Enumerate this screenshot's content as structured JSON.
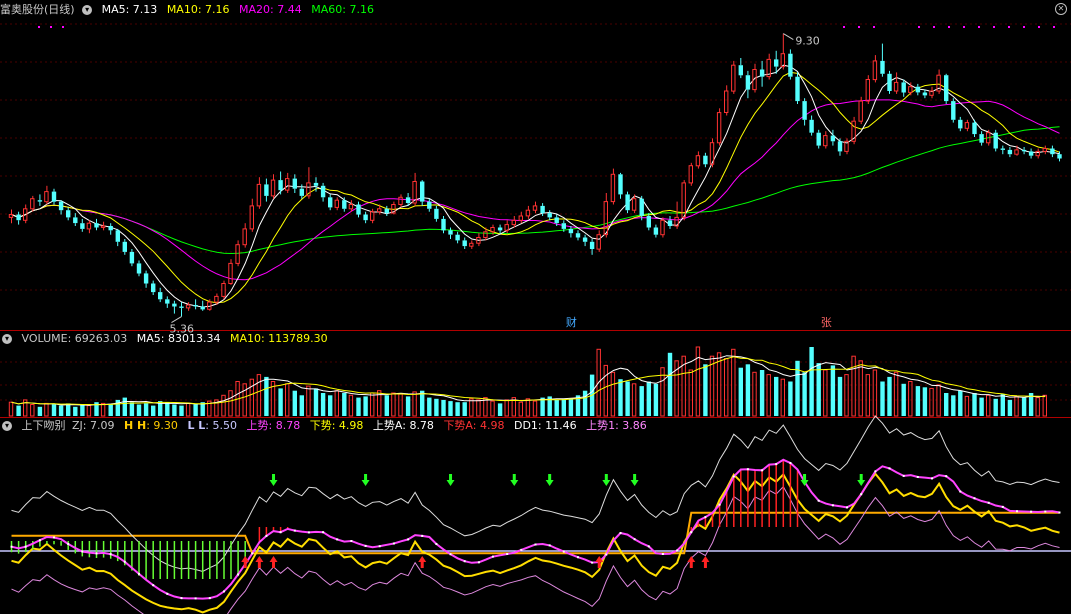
{
  "colors": {
    "up": "#ff3232",
    "down": "#54ffff",
    "ma5": "#ffffff",
    "ma10": "#ffff00",
    "ma20": "#ff00ff",
    "ma60": "#00ff00",
    "pane_border": "#b00000"
  },
  "price_panel": {
    "title": "富奥股份(日线)",
    "ma5": "MA5: 7.13",
    "ma10": "MA10: 7.16",
    "ma20": "MA20: 7.44",
    "ma60": "MA60: 7.16",
    "high_label": "9.30",
    "low_label": "5.36",
    "marker_cai": "财",
    "marker_zhang": "张"
  },
  "volume_panel": {
    "volume": "VOLUME: 69263.03",
    "ma5": "MA5: 83013.34",
    "ma10": "MA10: 113789.30"
  },
  "indicator_panel": {
    "name": "上下吻别",
    "zj": "ZJ: 7.09",
    "hh_label": "H H",
    "hh_value": ": 9.30",
    "ll_label": "L L",
    "ll_value": ": 5.50",
    "up_trend": "上势: 8.78",
    "down_trend": "下势: 4.98",
    "up_trend_a": "上势A: 8.78",
    "down_trend_a": "下势A: 4.98",
    "dd1": "DD1: 11.46",
    "up_trend_1": "上势1: 3.86"
  },
  "chart_data": {
    "type": "candlestick",
    "y_range": [
      5.2,
      9.35
    ],
    "high": 9.3,
    "low": 5.36,
    "candles": [
      [
        6.74,
        6.78,
        6.85,
        6.66
      ],
      [
        6.78,
        6.7,
        6.82,
        6.64
      ],
      [
        6.7,
        6.86,
        6.92,
        6.66
      ],
      [
        6.86,
        7.0,
        7.04,
        6.82
      ],
      [
        6.98,
        6.96,
        7.06,
        6.9
      ],
      [
        6.96,
        7.1,
        7.18,
        6.92
      ],
      [
        7.1,
        6.96,
        7.14,
        6.92
      ],
      [
        6.96,
        6.84,
        6.98,
        6.78
      ],
      [
        6.84,
        6.74,
        6.88,
        6.7
      ],
      [
        6.74,
        6.66,
        6.8,
        6.62
      ],
      [
        6.66,
        6.58,
        6.72,
        6.54
      ],
      [
        6.58,
        6.66,
        6.7,
        6.52
      ],
      [
        6.66,
        6.6,
        6.72,
        6.56
      ],
      [
        6.6,
        6.62,
        6.68,
        6.56
      ],
      [
        6.62,
        6.56,
        6.66,
        6.5
      ],
      [
        6.56,
        6.4,
        6.58,
        6.34
      ],
      [
        6.4,
        6.26,
        6.44,
        6.22
      ],
      [
        6.26,
        6.1,
        6.3,
        6.06
      ],
      [
        6.1,
        5.96,
        6.14,
        5.92
      ],
      [
        5.96,
        5.82,
        6.0,
        5.76
      ],
      [
        5.82,
        5.7,
        5.86,
        5.66
      ],
      [
        5.7,
        5.6,
        5.76,
        5.56
      ],
      [
        5.6,
        5.54,
        5.64,
        5.48
      ],
      [
        5.54,
        5.5,
        5.58,
        5.4
      ],
      [
        5.5,
        5.48,
        5.56,
        5.36
      ],
      [
        5.48,
        5.52,
        5.56,
        5.44
      ],
      [
        5.52,
        5.5,
        5.6,
        5.46
      ],
      [
        5.5,
        5.46,
        5.58,
        5.44
      ],
      [
        5.46,
        5.56,
        5.6,
        5.44
      ],
      [
        5.56,
        5.64,
        5.68,
        5.52
      ],
      [
        5.64,
        5.82,
        5.86,
        5.6
      ],
      [
        5.82,
        6.1,
        6.16,
        5.8
      ],
      [
        6.1,
        6.36,
        6.42,
        6.06
      ],
      [
        6.36,
        6.58,
        6.66,
        6.32
      ],
      [
        6.58,
        6.9,
        7.0,
        6.54
      ],
      [
        6.9,
        7.2,
        7.3,
        6.86
      ],
      [
        7.2,
        7.04,
        7.28,
        6.96
      ],
      [
        7.04,
        7.26,
        7.34,
        7.0
      ],
      [
        7.26,
        7.12,
        7.38,
        7.06
      ],
      [
        7.12,
        7.28,
        7.36,
        7.08
      ],
      [
        7.28,
        7.14,
        7.34,
        7.08
      ],
      [
        7.14,
        7.04,
        7.2,
        7.0
      ],
      [
        7.04,
        7.22,
        7.44,
        7.0
      ],
      [
        7.22,
        7.18,
        7.3,
        7.1
      ],
      [
        7.18,
        7.02,
        7.22,
        6.96
      ],
      [
        7.02,
        6.88,
        7.06,
        6.84
      ],
      [
        6.88,
        6.98,
        7.02,
        6.84
      ],
      [
        6.98,
        6.86,
        7.02,
        6.82
      ],
      [
        6.86,
        6.92,
        6.98,
        6.82
      ],
      [
        6.92,
        6.78,
        6.96,
        6.74
      ],
      [
        6.78,
        6.7,
        6.82,
        6.66
      ],
      [
        6.7,
        6.82,
        6.86,
        6.66
      ],
      [
        6.82,
        6.86,
        6.92,
        6.78
      ],
      [
        6.86,
        6.8,
        6.9,
        6.76
      ],
      [
        6.8,
        6.92,
        6.96,
        6.78
      ],
      [
        6.92,
        7.02,
        7.06,
        6.88
      ],
      [
        7.02,
        6.94,
        7.08,
        6.9
      ],
      [
        6.94,
        7.24,
        7.36,
        6.9
      ],
      [
        7.24,
        6.96,
        7.26,
        6.9
      ],
      [
        6.96,
        6.86,
        7.0,
        6.82
      ],
      [
        6.86,
        6.72,
        6.9,
        6.68
      ],
      [
        6.72,
        6.56,
        6.76,
        6.52
      ],
      [
        6.56,
        6.5,
        6.6,
        6.44
      ],
      [
        6.5,
        6.42,
        6.54,
        6.38
      ],
      [
        6.42,
        6.34,
        6.46,
        6.3
      ],
      [
        6.34,
        6.38,
        6.42,
        6.3
      ],
      [
        6.38,
        6.46,
        6.52,
        6.34
      ],
      [
        6.46,
        6.54,
        6.6,
        6.42
      ],
      [
        6.54,
        6.6,
        6.64,
        6.5
      ],
      [
        6.6,
        6.56,
        6.64,
        6.52
      ],
      [
        6.56,
        6.64,
        6.7,
        6.52
      ],
      [
        6.64,
        6.7,
        6.76,
        6.6
      ],
      [
        6.7,
        6.76,
        6.82,
        6.66
      ],
      [
        6.76,
        6.84,
        6.9,
        6.72
      ],
      [
        6.84,
        6.9,
        6.96,
        6.8
      ],
      [
        6.9,
        6.8,
        6.94,
        6.76
      ],
      [
        6.8,
        6.74,
        6.84,
        6.7
      ],
      [
        6.74,
        6.66,
        6.78,
        6.62
      ],
      [
        6.66,
        6.58,
        6.7,
        6.54
      ],
      [
        6.58,
        6.52,
        6.62,
        6.46
      ],
      [
        6.52,
        6.46,
        6.56,
        6.42
      ],
      [
        6.46,
        6.4,
        6.5,
        6.34
      ],
      [
        6.4,
        6.3,
        6.44,
        6.22
      ],
      [
        6.3,
        6.5,
        6.56,
        6.26
      ],
      [
        6.5,
        6.96,
        7.08,
        6.46
      ],
      [
        6.96,
        7.34,
        7.42,
        6.92
      ],
      [
        7.34,
        7.06,
        7.36,
        7.0
      ],
      [
        7.06,
        6.84,
        7.1,
        6.8
      ],
      [
        6.84,
        7.0,
        7.06,
        6.8
      ],
      [
        7.0,
        6.76,
        7.04,
        6.7
      ],
      [
        6.76,
        6.6,
        6.8,
        6.56
      ],
      [
        6.6,
        6.5,
        6.64,
        6.46
      ],
      [
        6.5,
        6.7,
        6.74,
        6.46
      ],
      [
        6.7,
        6.62,
        6.76,
        6.58
      ],
      [
        6.62,
        6.74,
        6.96,
        6.58
      ],
      [
        6.74,
        7.22,
        7.26,
        6.7
      ],
      [
        7.22,
        7.46,
        7.5,
        7.18
      ],
      [
        7.46,
        7.6,
        7.66,
        7.42
      ],
      [
        7.6,
        7.48,
        7.64,
        7.44
      ],
      [
        7.48,
        7.78,
        7.84,
        7.44
      ],
      [
        7.78,
        8.2,
        8.26,
        7.74
      ],
      [
        8.2,
        8.5,
        8.58,
        8.16
      ],
      [
        8.5,
        8.86,
        8.92,
        8.46
      ],
      [
        8.86,
        8.72,
        8.96,
        8.68
      ],
      [
        8.72,
        8.52,
        8.78,
        8.4
      ],
      [
        8.52,
        8.8,
        8.88,
        8.48
      ],
      [
        8.8,
        8.7,
        8.92,
        8.56
      ],
      [
        8.7,
        8.94,
        9.02,
        8.66
      ],
      [
        8.94,
        8.84,
        9.06,
        8.74
      ],
      [
        8.84,
        9.02,
        9.3,
        8.8
      ],
      [
        9.02,
        8.7,
        9.08,
        8.66
      ],
      [
        8.7,
        8.36,
        8.76,
        8.32
      ],
      [
        8.36,
        8.1,
        8.4,
        8.02
      ],
      [
        8.1,
        7.92,
        8.16,
        7.88
      ],
      [
        7.92,
        7.74,
        7.96,
        7.7
      ],
      [
        7.74,
        7.88,
        7.94,
        7.7
      ],
      [
        7.88,
        7.8,
        7.96,
        7.74
      ],
      [
        7.8,
        7.66,
        7.84,
        7.6
      ],
      [
        7.66,
        7.8,
        7.84,
        7.62
      ],
      [
        7.8,
        8.08,
        8.14,
        7.76
      ],
      [
        8.08,
        8.36,
        8.42,
        8.04
      ],
      [
        8.36,
        8.66,
        8.72,
        8.32
      ],
      [
        8.66,
        8.92,
        9.0,
        8.62
      ],
      [
        8.92,
        8.74,
        9.16,
        8.7
      ],
      [
        8.74,
        8.5,
        8.78,
        8.46
      ],
      [
        8.5,
        8.62,
        8.76,
        8.46
      ],
      [
        8.62,
        8.48,
        8.66,
        8.42
      ],
      [
        8.48,
        8.56,
        8.62,
        8.44
      ],
      [
        8.56,
        8.48,
        8.6,
        8.44
      ],
      [
        8.48,
        8.44,
        8.52,
        8.4
      ],
      [
        8.44,
        8.5,
        8.56,
        8.4
      ],
      [
        8.5,
        8.72,
        8.8,
        8.46
      ],
      [
        8.72,
        8.36,
        8.74,
        8.32
      ],
      [
        8.36,
        8.1,
        8.4,
        8.06
      ],
      [
        8.1,
        7.98,
        8.14,
        7.94
      ],
      [
        7.98,
        8.06,
        8.1,
        7.94
      ],
      [
        8.06,
        7.9,
        8.1,
        7.86
      ],
      [
        7.9,
        7.78,
        7.94,
        7.74
      ],
      [
        7.78,
        7.92,
        7.96,
        7.74
      ],
      [
        7.92,
        7.7,
        7.96,
        7.66
      ],
      [
        7.7,
        7.68,
        7.74,
        7.62
      ],
      [
        7.68,
        7.62,
        7.72,
        7.58
      ],
      [
        7.62,
        7.68,
        7.74,
        7.6
      ],
      [
        7.68,
        7.66,
        7.72,
        7.62
      ],
      [
        7.66,
        7.6,
        7.7,
        7.56
      ],
      [
        7.6,
        7.66,
        7.7,
        7.56
      ],
      [
        7.66,
        7.7,
        7.74,
        7.62
      ],
      [
        7.7,
        7.62,
        7.74,
        7.58
      ],
      [
        7.62,
        7.56,
        7.66,
        7.52
      ]
    ],
    "volume": [
      12,
      9,
      14,
      10,
      8,
      11,
      10,
      9,
      11,
      8,
      10,
      9,
      12,
      11,
      10,
      14,
      16,
      12,
      10,
      11,
      9,
      13,
      12,
      10,
      9,
      11,
      10,
      12,
      13,
      14,
      18,
      22,
      30,
      28,
      32,
      36,
      34,
      30,
      24,
      28,
      22,
      18,
      26,
      24,
      20,
      18,
      22,
      20,
      18,
      16,
      17,
      20,
      22,
      18,
      20,
      19,
      17,
      21,
      22,
      16,
      15,
      14,
      13,
      12,
      12,
      15,
      14,
      16,
      13,
      11,
      14,
      16,
      12,
      15,
      13,
      16,
      17,
      14,
      15,
      15,
      18,
      22,
      36,
      58,
      44,
      38,
      32,
      30,
      28,
      26,
      30,
      28,
      42,
      55,
      48,
      52,
      40,
      60,
      45,
      52,
      55,
      50,
      58,
      42,
      45,
      38,
      40,
      36,
      34,
      32,
      30,
      48,
      38,
      60,
      46,
      40,
      44,
      34,
      36,
      52,
      48,
      36,
      40,
      30,
      34,
      38,
      28,
      30,
      26,
      25,
      24,
      27,
      20,
      18,
      22,
      17,
      20,
      16,
      18,
      15,
      19,
      14,
      17,
      16,
      20,
      16,
      18
    ]
  }
}
